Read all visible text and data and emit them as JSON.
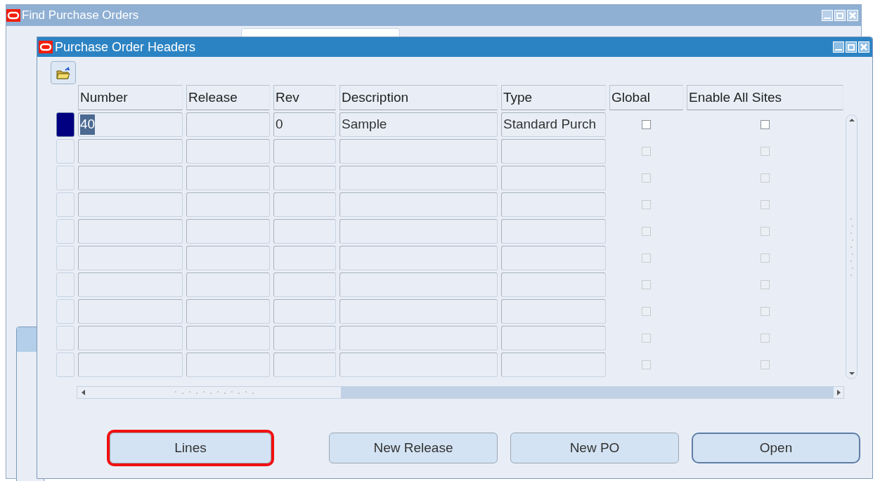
{
  "back_window": {
    "title": "Find Purchase Orders"
  },
  "window": {
    "title": "Purchase Order Headers"
  },
  "table": {
    "columns": [
      "Number",
      "Release",
      "Rev",
      "Description",
      "Type",
      "Global",
      "Enable All Sites"
    ],
    "rows": [
      {
        "current": true,
        "number": "40",
        "rev": "0",
        "description": "Sample",
        "type": "Standard Purch",
        "global": false,
        "enable_all_sites": false,
        "disabled": false
      },
      {
        "current": false,
        "global": false,
        "enable_all_sites": false,
        "disabled": true
      },
      {
        "current": false,
        "global": false,
        "enable_all_sites": false,
        "disabled": true
      },
      {
        "current": false,
        "global": false,
        "enable_all_sites": false,
        "disabled": true
      },
      {
        "current": false,
        "global": false,
        "enable_all_sites": false,
        "disabled": true
      },
      {
        "current": false,
        "global": false,
        "enable_all_sites": false,
        "disabled": true
      },
      {
        "current": false,
        "global": false,
        "enable_all_sites": false,
        "disabled": true
      },
      {
        "current": false,
        "global": false,
        "enable_all_sites": false,
        "disabled": true
      },
      {
        "current": false,
        "global": false,
        "enable_all_sites": false,
        "disabled": true
      },
      {
        "current": false,
        "global": false,
        "enable_all_sites": false,
        "disabled": true
      }
    ]
  },
  "buttons": [
    {
      "label": "Lines",
      "highlighted": true,
      "default": false
    },
    {
      "label": "New Release",
      "highlighted": false,
      "default": false
    },
    {
      "label": "New PO",
      "highlighted": false,
      "default": false
    },
    {
      "label": "Open",
      "highlighted": false,
      "default": true
    }
  ]
}
